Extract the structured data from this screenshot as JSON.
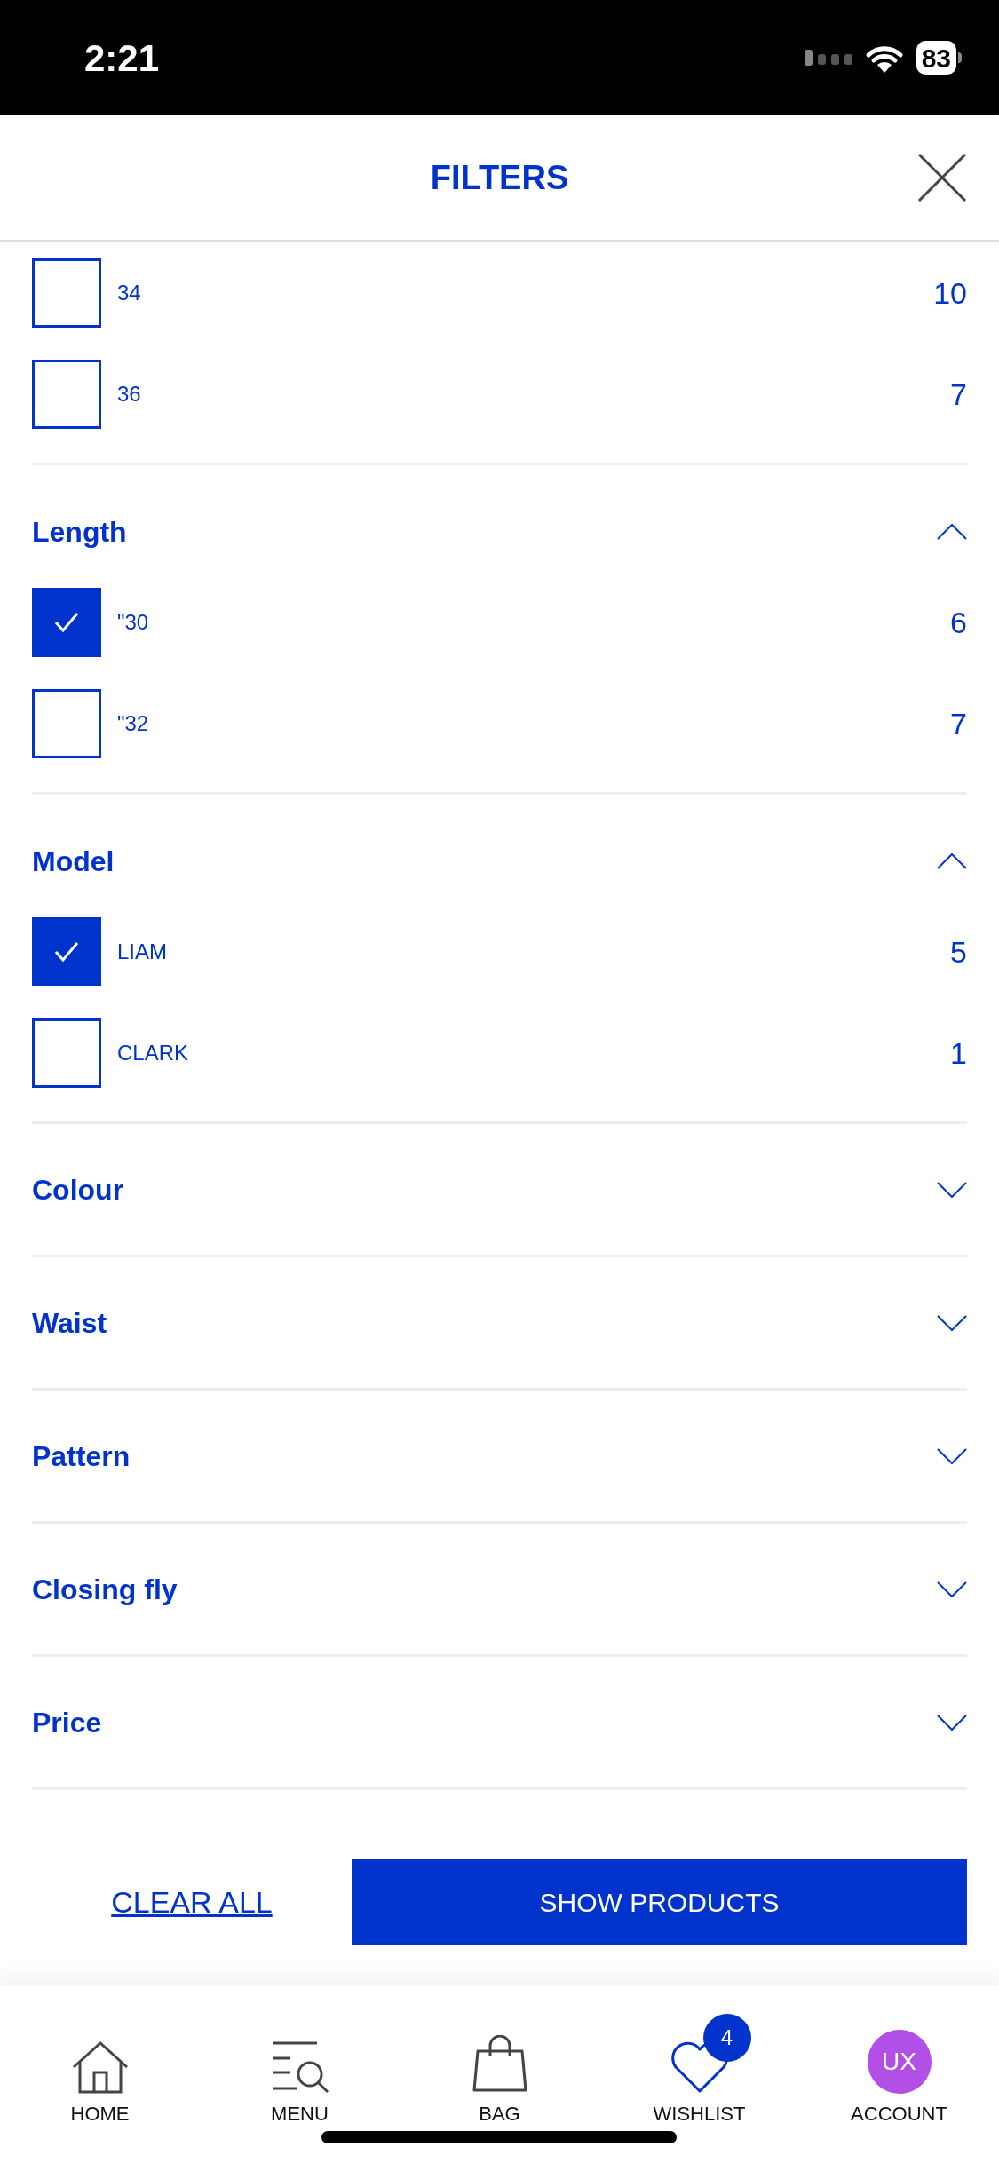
{
  "status_bar": {
    "time": "2:21",
    "battery": "83"
  },
  "header": {
    "title": "FILTERS"
  },
  "sections": [
    {
      "options": [
        {
          "label": "34",
          "count": "10",
          "checked": false
        },
        {
          "label": "36",
          "count": "7",
          "checked": false
        }
      ]
    },
    {
      "title": "Length",
      "expanded": true,
      "options": [
        {
          "label": "\"30",
          "count": "6",
          "checked": true
        },
        {
          "label": "\"32",
          "count": "7",
          "checked": false
        }
      ]
    },
    {
      "title": "Model",
      "expanded": true,
      "options": [
        {
          "label": "LIAM",
          "count": "5",
          "checked": true
        },
        {
          "label": "CLARK",
          "count": "1",
          "checked": false
        }
      ]
    },
    {
      "title": "Colour",
      "expanded": false
    },
    {
      "title": "Waist",
      "expanded": false
    },
    {
      "title": "Pattern",
      "expanded": false
    },
    {
      "title": "Closing fly",
      "expanded": false
    },
    {
      "title": "Price",
      "expanded": false
    }
  ],
  "actions": {
    "clear": "CLEAR ALL",
    "show": "SHOW PRODUCTS"
  },
  "tab_bar": [
    {
      "kind": "home",
      "label": "HOME"
    },
    {
      "kind": "menu",
      "label": "MENU"
    },
    {
      "kind": "bag",
      "label": "BAG"
    },
    {
      "kind": "wishlist",
      "label": "WISHLIST",
      "badge": "4"
    },
    {
      "kind": "account",
      "label": "ACCOUNT",
      "initials": "UX"
    }
  ]
}
